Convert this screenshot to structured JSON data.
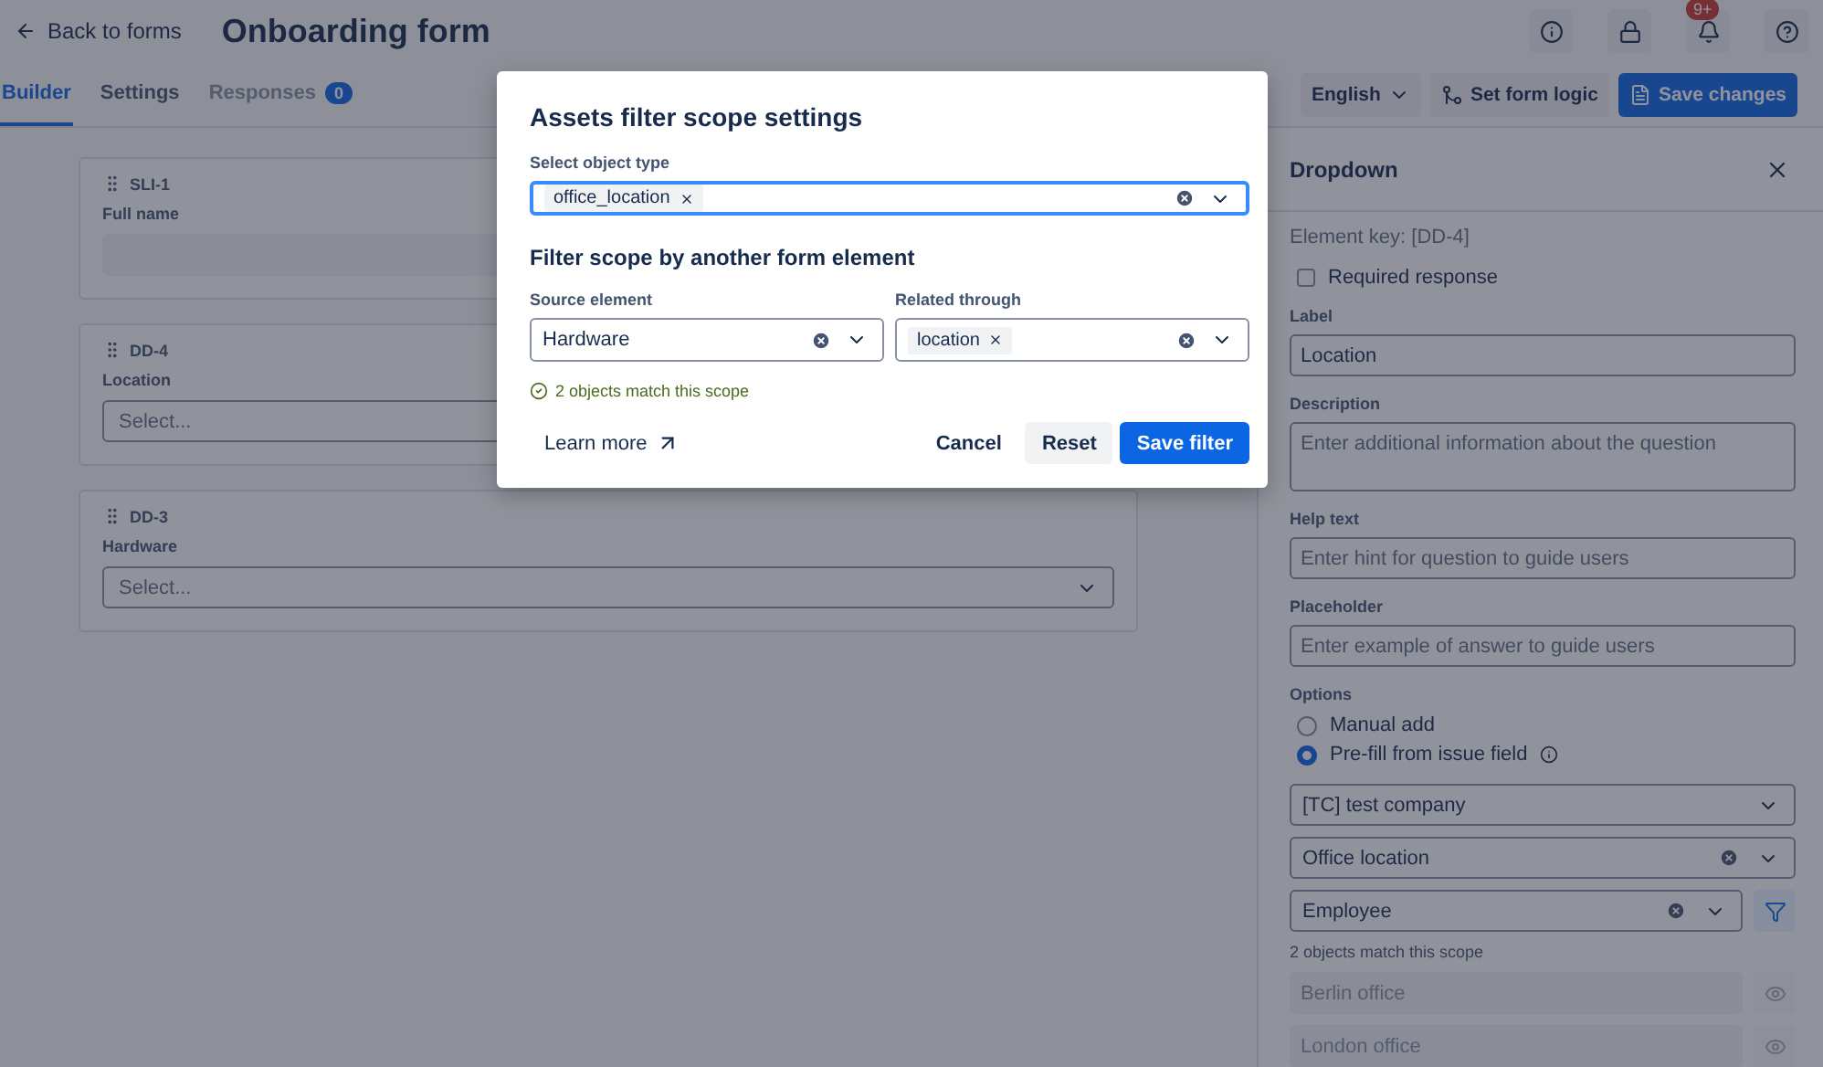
{
  "header": {
    "back_link": "Back to forms",
    "title": "Onboarding form",
    "notification_badge": "9+"
  },
  "tabs": [
    {
      "label": "Builder",
      "selected": true
    },
    {
      "label": "Settings",
      "selected": false
    },
    {
      "label": "Responses",
      "selected": false,
      "disabled": true,
      "badge": "0"
    }
  ],
  "toolbar": {
    "language": "English",
    "logic_button": "Set form logic",
    "save_button": "Save changes"
  },
  "form_elements": [
    {
      "key": "SLI-1",
      "label": "Full name",
      "kind": "text"
    },
    {
      "key": "DD-4",
      "label": "Location",
      "kind": "select",
      "placeholder": "Select..."
    },
    {
      "key": "DD-3",
      "label": "Hardware",
      "kind": "select",
      "placeholder": "Select..."
    }
  ],
  "panel": {
    "title": "Dropdown",
    "element_key": "Element key: [DD-4]",
    "required": {
      "label": "Required response",
      "checked": false
    },
    "fields": [
      {
        "label": "Label",
        "kind": "input",
        "value": "Location"
      },
      {
        "label": "Description",
        "kind": "textarea",
        "placeholder": "Enter additional information about the question"
      },
      {
        "label": "Help text",
        "kind": "input",
        "placeholder": "Enter hint for question to guide users"
      },
      {
        "label": "Placeholder",
        "kind": "input",
        "placeholder": "Enter example of answer to guide users"
      }
    ],
    "options": {
      "label": "Options",
      "radios": [
        {
          "label": "Manual add",
          "selected": false,
          "info": false
        },
        {
          "label": "Pre-fill from issue field",
          "selected": true,
          "info": true
        }
      ],
      "selects": [
        {
          "value": "[TC] test company",
          "clearable": false,
          "filter": false
        },
        {
          "value": "Office location",
          "clearable": true,
          "filter": false
        },
        {
          "value": "Employee",
          "clearable": true,
          "filter": true,
          "filter_active": true
        }
      ],
      "match_text": "2 objects match this scope",
      "items": [
        {
          "label": "Berlin office"
        },
        {
          "label": "London office"
        }
      ]
    }
  },
  "modal": {
    "title": "Assets filter scope settings",
    "object_type": {
      "label": "Select object type",
      "tags": [
        "office_location"
      ],
      "focused": true
    },
    "section_title": "Filter scope by another form element",
    "source": {
      "label": "Source element",
      "value": "Hardware"
    },
    "related": {
      "label": "Related through",
      "tags": [
        "location"
      ]
    },
    "status": "2 objects match this scope",
    "learn_more": "Learn more",
    "buttons": [
      {
        "label": "Cancel",
        "kind": "subtle"
      },
      {
        "label": "Reset",
        "kind": "default"
      },
      {
        "label": "Save filter",
        "kind": "primary"
      }
    ]
  }
}
